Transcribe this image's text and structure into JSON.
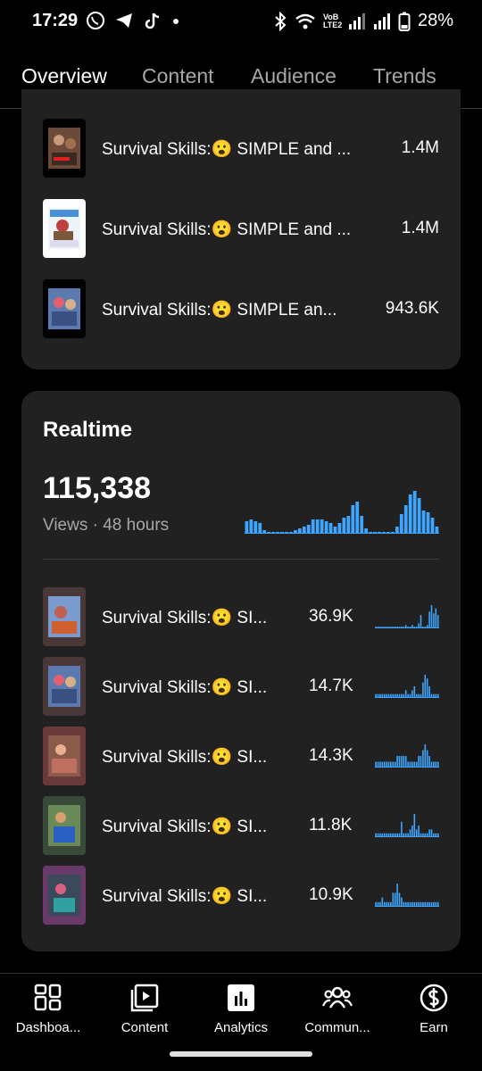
{
  "status_bar": {
    "time": "17:29",
    "battery": "28%",
    "network_label": "VoB LTE2"
  },
  "tabs": [
    {
      "label": "Overview",
      "active": true
    },
    {
      "label": "Content",
      "active": false
    },
    {
      "label": "Audience",
      "active": false
    },
    {
      "label": "Trends",
      "active": false
    }
  ],
  "top_videos": [
    {
      "title": "Survival Skills:😮 SIMPLE and ...",
      "value": "1.4M"
    },
    {
      "title": "Survival Skills:😮 SIMPLE and ...",
      "value": "1.4M"
    },
    {
      "title": "Survival Skills:😮 SIMPLE an...",
      "value": "943.6K"
    }
  ],
  "realtime": {
    "title": "Realtime",
    "views": "115,338",
    "caption": "Views · 48 hours",
    "accent_color": "#3ea6ff",
    "bars": [
      7,
      8,
      7,
      6,
      2,
      1,
      1,
      1,
      1,
      1,
      1,
      2,
      3,
      4,
      5,
      8,
      8,
      8,
      7,
      6,
      4,
      6,
      9,
      10,
      16,
      18,
      10,
      3,
      1,
      1,
      1,
      1,
      1,
      1,
      4,
      11,
      16,
      22,
      24,
      20,
      13,
      12,
      9,
      4
    ],
    "videos": [
      {
        "title": "Survival Skills:😮 SI...",
        "views": "36.9K",
        "spark": [
          1,
          1,
          1,
          1,
          1,
          1,
          1,
          1,
          1,
          1,
          1,
          1,
          1,
          1,
          2,
          1,
          1,
          2,
          1,
          1,
          3,
          8,
          1,
          1,
          2,
          10,
          14,
          9,
          12,
          8
        ]
      },
      {
        "title": "Survival Skills:😮 SI...",
        "views": "14.7K",
        "spark": [
          1,
          1,
          1,
          1,
          1,
          1,
          1,
          1,
          1,
          1,
          1,
          1,
          1,
          1,
          2,
          1,
          1,
          2,
          3,
          1,
          1,
          1,
          4,
          6,
          5,
          3,
          1,
          1,
          1,
          1
        ]
      },
      {
        "title": "Survival Skills:😮 SI...",
        "views": "14.3K",
        "spark": [
          1,
          1,
          1,
          1,
          1,
          1,
          1,
          1,
          1,
          1,
          2,
          2,
          2,
          2,
          2,
          1,
          1,
          1,
          1,
          1,
          2,
          2,
          3,
          4,
          3,
          2,
          1,
          1,
          1,
          1
        ]
      },
      {
        "title": "Survival Skills:😮 SI...",
        "views": "11.8K",
        "spark": [
          1,
          1,
          1,
          1,
          1,
          1,
          1,
          1,
          1,
          1,
          1,
          1,
          4,
          1,
          1,
          1,
          2,
          3,
          6,
          2,
          3,
          1,
          1,
          1,
          1,
          2,
          2,
          1,
          1,
          1
        ]
      },
      {
        "title": "Survival Skills:😮 SI...",
        "views": "10.9K",
        "spark": [
          1,
          1,
          1,
          2,
          1,
          1,
          1,
          1,
          3,
          3,
          5,
          3,
          2,
          1,
          1,
          1,
          1,
          1,
          1,
          1,
          1,
          1,
          1,
          1,
          1,
          1,
          1,
          1,
          1,
          1
        ]
      }
    ]
  },
  "bottom_nav": [
    {
      "label": "Dashboa...",
      "icon": "dashboard-icon"
    },
    {
      "label": "Content",
      "icon": "content-icon"
    },
    {
      "label": "Analytics",
      "icon": "analytics-icon"
    },
    {
      "label": "Commun...",
      "icon": "community-icon"
    },
    {
      "label": "Earn",
      "icon": "earn-icon"
    }
  ]
}
